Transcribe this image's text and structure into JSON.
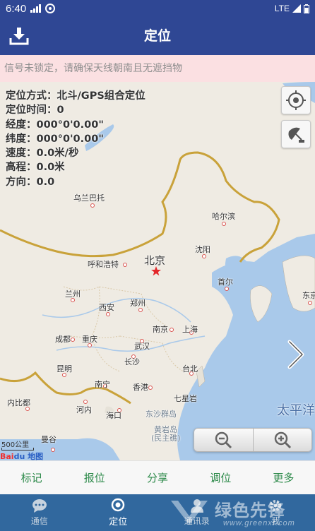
{
  "status_bar": {
    "time": "6:40",
    "network": "LTE"
  },
  "header": {
    "title": "定位"
  },
  "warning": "信号未锁定，请确保天线朝南且无遮挡物",
  "info": {
    "mode": "定位方式：北斗/GPS组合定位",
    "time": "定位时间：0",
    "longitude": "经度：000°0'0.00\"",
    "latitude": "纬度：000°0'0.00\"",
    "speed": "速度：0.0米/秒",
    "altitude": "高程：0.0米",
    "direction": "方向：0.0"
  },
  "map": {
    "cities": {
      "ulaanbaatar": "乌兰巴托",
      "harbin": "哈尔滨",
      "hohhot": "呼和浩特",
      "beijing": "北京",
      "shenyang": "沈阳",
      "seoul": "首尔",
      "tokyo": "东京",
      "lanzhou": "兰州",
      "xian": "西安",
      "zhengzhou": "郑州",
      "nanjing": "南京",
      "shanghai": "上海",
      "chengdu": "成都",
      "chongqing": "重庆",
      "wuhan": "武汉",
      "changsha": "长沙",
      "kunming": "昆明",
      "nanning": "南宁",
      "hongkong": "香港",
      "taipei": "台北",
      "qixingyan": "七星岩",
      "naypyidaw": "内比都",
      "hanoi": "河内",
      "haikou": "海口",
      "dongsha": "东沙群岛",
      "huangyan": "黄岩岛",
      "huangyan_note": "(民主礁)",
      "vientiane": "曼谷",
      "pacific": "太平洋"
    },
    "scale": "500公里",
    "baidu_logo": "Bai",
    "baidu_logo2": "du 地图"
  },
  "actions": [
    "标记",
    "报位",
    "分享",
    "调位",
    "更多"
  ],
  "nav": [
    "通信",
    "定位",
    "通讯录",
    "我"
  ],
  "watermark": {
    "main": "绿色先锋",
    "url": "www.greenxf.com"
  },
  "colors": {
    "primary": "#2f4794",
    "nav": "#31689e",
    "action_text": "#2d8a4a",
    "warning_bg": "#fbe0e2",
    "border": "#c9a23a",
    "sea": "#a9c9ea"
  }
}
